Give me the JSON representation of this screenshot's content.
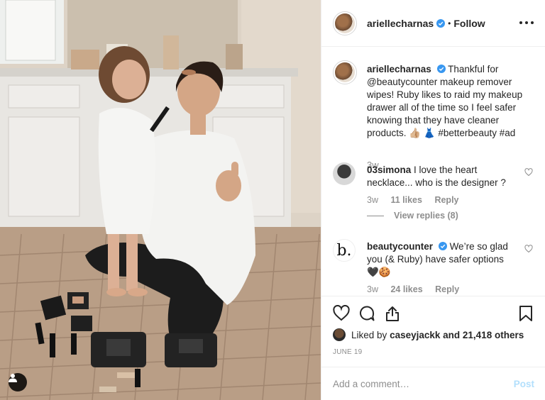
{
  "post": {
    "username": "ariellecharnas",
    "separator": "•",
    "follow_label": "Follow",
    "caption": {
      "username": "ariellecharnas",
      "text_before_mention": "Thankful for",
      "mention": "@beautycounter",
      "text_after_mention": "makeup remover wipes! Ruby likes to raid my makeup drawer all of the time so I feel safer knowing that they have cleaner products. 👍🏼 👗 #betterbeauty #ad",
      "time": "3w"
    },
    "comments": [
      {
        "username": "03simona",
        "text": "I love the heart necklace... who is the designer ?",
        "time": "3w",
        "likes": "11 likes",
        "reply_label": "Reply",
        "view_replies": "View replies (8)"
      },
      {
        "username": "beautycounter",
        "avatar_letter": "b.",
        "text": "We’re so glad you (& Ruby) have safer options",
        "emojis": "🖤🍪",
        "time": "3w",
        "likes": "24 likes",
        "reply_label": "Reply"
      }
    ],
    "liked_by_prefix": "Liked by",
    "liked_by_user": "caseyjackk",
    "liked_by_suffix": "and 21,418 others",
    "date": "JUNE 19",
    "add_comment_placeholder": "Add a comment…",
    "post_label": "Post"
  },
  "icons": {
    "verified": "verified-badge-icon",
    "more": "more-options-icon",
    "heart": "heart-icon",
    "comment": "comment-icon",
    "share": "share-icon",
    "save": "bookmark-icon",
    "user_tag": "user-tag-icon"
  },
  "colors": {
    "text": "#262626",
    "secondary": "#8e8e8e",
    "border": "#efefef",
    "verified": "#3897f0",
    "post_button": "#b2dffc"
  }
}
